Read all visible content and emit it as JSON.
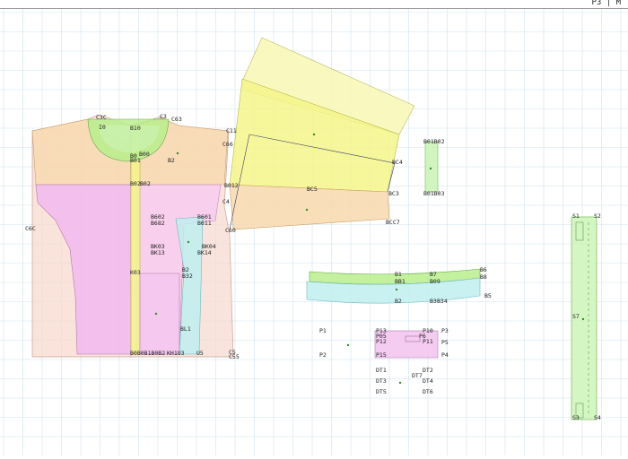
{
  "header": {
    "corner_label": "P3 | M"
  },
  "colors": {
    "grid": "#cfe3ee",
    "skin": "#f7d9cf",
    "peach": "#f8d8ae",
    "pink": "#f2b8ef",
    "light_pink": "#f7c9f0",
    "green": "#b8ee8c",
    "light_green": "#cdf4b8",
    "yellow": "#f4f58a",
    "light_yellow": "#f8f7b4",
    "cyan": "#bfeef0",
    "magenta": "#f3c6f0",
    "outline": "#7a7a7a"
  },
  "labels": {
    "c3c": "C3C",
    "c3": "C3",
    "c63": "C63",
    "i0": "I0",
    "b10": "B10",
    "c11": "C11",
    "c66": "C66",
    "b0": "B0",
    "b01": "B01",
    "b00": "B00",
    "b2": "B2",
    "bc4": "BC4",
    "b02_top": "B02",
    "b02_mid": "B02",
    "b012": "B012",
    "bc3": "BC3",
    "bc5": "BC5",
    "c4": "C4",
    "c6c": "C6C",
    "bcc7": "BCC7",
    "c60": "C60",
    "b602": "B602",
    "b682": "B682",
    "b601": "B601",
    "b611": "B611",
    "bk03": "BK03",
    "bk13": "BK13",
    "bk04": "BK04",
    "bk14": "BK14",
    "b2_lo": "B2",
    "b32": "B32",
    "k03": "K03",
    "bl1": "BL1",
    "c5": "C5",
    "c55": "C55",
    "kh1u3": "KH1U3",
    "u5": "U5",
    "bottom_codes": "B0B0B1B0B2",
    "b01_b03": "B01B02",
    "b01_b03_lo": "B01B03",
    "bb1": "B1",
    "bbb1": "BB1",
    "bbb7": "B7",
    "bbb8": "B8",
    "bbb9": "B09",
    "bb6": "B6",
    "bb2": "B2",
    "bb3": "B3",
    "bb4": "B34",
    "bb5": "B5",
    "p1": "P1",
    "p2": "P2",
    "p13": "P13",
    "p05": "P05",
    "p10": "P10",
    "p3": "P3",
    "p12": "P12",
    "p6": "P6",
    "p11": "P11",
    "p5": "P5",
    "p15": "P15",
    "p4": "P4",
    "dt1": "DT1",
    "dt2": "DT2",
    "dt7": "DT7",
    "dt3": "DT3",
    "dt4": "DT4",
    "dt5": "DT5",
    "dt6": "DT6",
    "s1": "S1",
    "s2": "S2",
    "s7": "S7",
    "s3": "S3",
    "s4": "S4"
  }
}
